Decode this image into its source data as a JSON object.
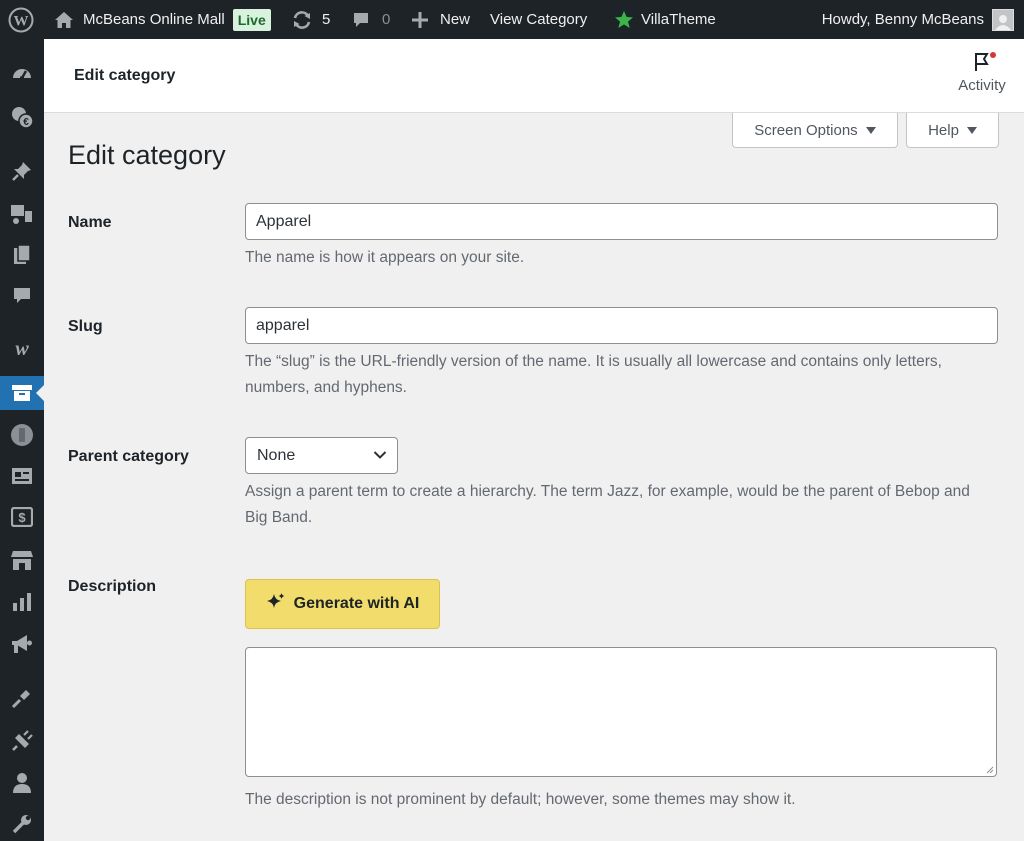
{
  "admin_bar": {
    "site_name": "McBeans Online Mall",
    "live_badge": "Live",
    "updates_count": "5",
    "comments_count": "0",
    "new_label": "New",
    "view_category_label": "View Category",
    "villatheme_label": "VillaTheme",
    "howdy_text": "Howdy, Benny McBeans"
  },
  "sidebar": {
    "icons": [
      "dashboard-icon",
      "currency-icon",
      "pin-icon",
      "media-icon",
      "pages-icon",
      "comments-icon",
      "woocommerce-icon",
      "products-icon",
      "payments-icon",
      "card-icon",
      "dollar-icon",
      "store-icon",
      "analytics-icon",
      "marketing-icon",
      "appearance-icon",
      "plugins-icon",
      "users-icon",
      "tools-icon"
    ],
    "active_icon": "products-icon"
  },
  "header": {
    "title": "Edit category",
    "activity_label": "Activity"
  },
  "screen_meta": {
    "screen_options_label": "Screen Options",
    "help_label": "Help"
  },
  "main": {
    "page_title": "Edit category",
    "name": {
      "label": "Name",
      "value": "Apparel",
      "description": "The name is how it appears on your site."
    },
    "slug": {
      "label": "Slug",
      "value": "apparel",
      "description": "The “slug” is the URL-friendly version of the name. It is usually all lowercase and contains only letters, numbers, and hyphens."
    },
    "parent": {
      "label": "Parent category",
      "selected": "None",
      "description": "Assign a parent term to create a hierarchy. The term Jazz, for example, would be the parent of Bebop and Big Band."
    },
    "description_field": {
      "label": "Description",
      "ai_button_label": "Generate with AI",
      "value": "",
      "help": "The description is not prominent by default; however, some themes may show it."
    }
  },
  "colors": {
    "admin_bar_bg": "#1d2327",
    "accent": "#2271b1",
    "ai_button_bg": "#f2dc6b",
    "live_badge_bg": "#d9f2dd",
    "villatheme_star": "#3ab54a",
    "activity_dot": "#d63638"
  }
}
